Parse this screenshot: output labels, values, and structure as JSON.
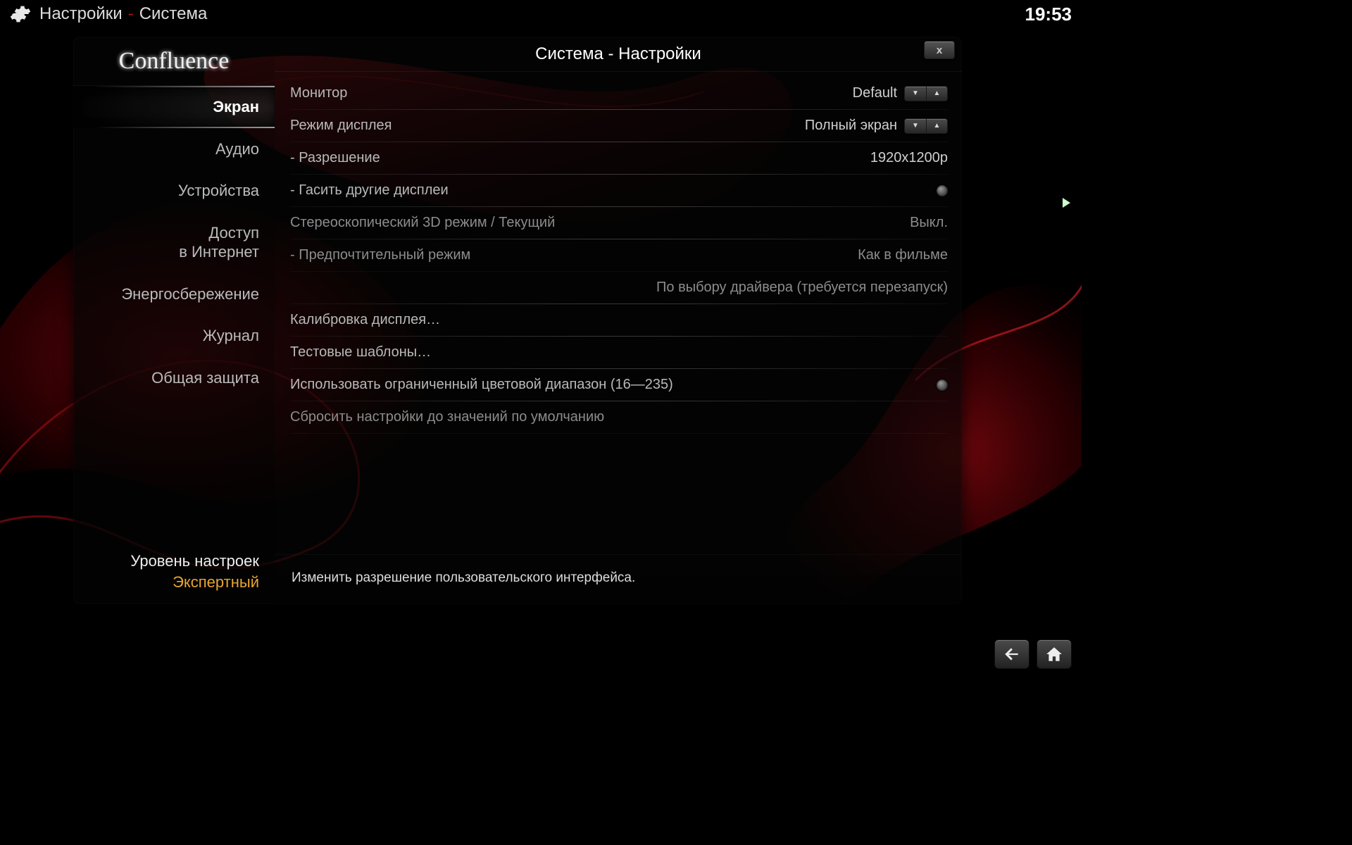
{
  "breadcrumb": {
    "part1": "Настройки",
    "part2": "Система"
  },
  "clock": "19:53",
  "brand": "Confluence",
  "header_title": "Система - Настройки",
  "close_label": "x",
  "sidebar": {
    "items": [
      {
        "label": "Экран"
      },
      {
        "label": "Аудио"
      },
      {
        "label": "Устройства"
      },
      {
        "label": "Доступ\nв Интернет"
      },
      {
        "label": "Энергосбережение"
      },
      {
        "label": "Журнал"
      },
      {
        "label": "Общая защита"
      }
    ],
    "level_label": "Уровень настроек",
    "level_value": "Экспертный"
  },
  "rows": {
    "monitor": {
      "label": "Монитор",
      "value": "Default"
    },
    "display_mode": {
      "label": "Режим дисплея",
      "value": "Полный экран"
    },
    "resolution": {
      "label": "Разрешение",
      "value": "1920x1200p"
    },
    "blank_other": {
      "label": "Гасить другие дисплеи"
    },
    "stereo3d": {
      "label": "Стереоскопический 3D режим / Текущий",
      "value": "Выкл."
    },
    "preferred_mode": {
      "label": "Предпочтительный режим",
      "value": "Как в фильме"
    },
    "driver_choice": {
      "value": "По выбору драйвера (требуется перезапуск)"
    },
    "calibrate": {
      "label": "Калибровка дисплея…"
    },
    "test_patterns": {
      "label": "Тестовые шаблоны…"
    },
    "limited_range": {
      "label": "Использовать ограниченный цветовой диапазон (16—235)"
    },
    "reset_defaults": {
      "label": "Сбросить настройки до значений по умолчанию"
    }
  },
  "footer_hint": "Изменить разрешение пользовательского интерфейса."
}
